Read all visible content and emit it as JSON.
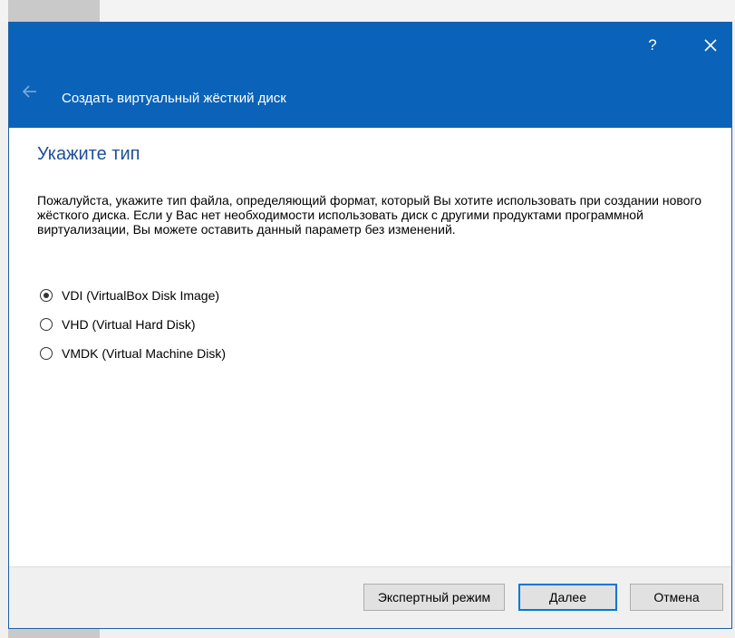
{
  "dialog": {
    "title": "Создать виртуальный жёсткий диск",
    "help_label": "?"
  },
  "page": {
    "heading": "Укажите тип",
    "description": "Пожалуйста, укажите тип файла, определяющий формат, который Вы хотите использовать при создании нового жёсткого диска. Если у Вас нет необходимости использовать диск с другими продуктами программной виртуализации, Вы можете оставить данный параметр без изменений."
  },
  "options": [
    {
      "label": "VDI (VirtualBox Disk Image)",
      "checked": true
    },
    {
      "label": "VHD (Virtual Hard Disk)",
      "checked": false
    },
    {
      "label": "VMDK (Virtual Machine Disk)",
      "checked": false
    }
  ],
  "footer": {
    "expert_label": "Экспертный режим",
    "next_label": "Далее",
    "cancel_label": "Отмена"
  },
  "colors": {
    "titlebar": "#0a63b8",
    "heading": "#1d4f9c",
    "default_button_border": "#0078d7"
  },
  "icons": {
    "back": "arrow-left-icon",
    "close": "close-icon"
  }
}
